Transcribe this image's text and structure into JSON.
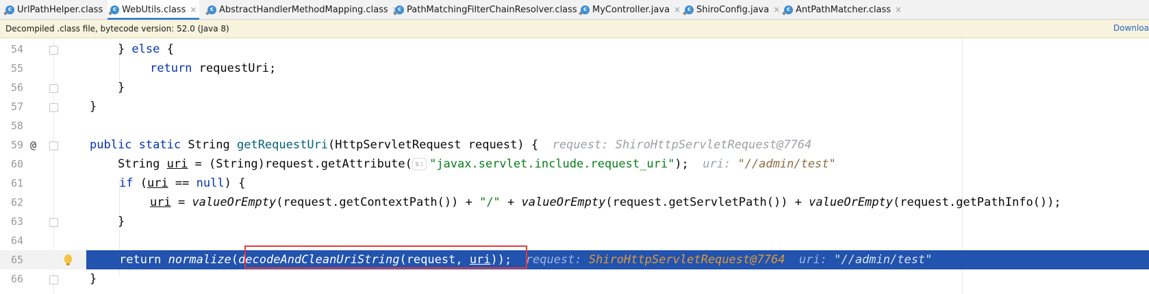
{
  "tabs": [
    {
      "label": "UrlPathHelper.class",
      "active": false,
      "icon": "class-icon"
    },
    {
      "label": "WebUtils.class",
      "active": true,
      "icon": "class-icon"
    },
    {
      "label": "AbstractHandlerMethodMapping.class",
      "active": false,
      "icon": "class-icon"
    },
    {
      "label": "PathMatchingFilterChainResolver.class",
      "active": false,
      "icon": "class-icon"
    },
    {
      "label": "MyController.java",
      "active": false,
      "icon": "class-icon"
    },
    {
      "label": "ShiroConfig.java",
      "active": false,
      "icon": "class-icon"
    },
    {
      "label": "AntPathMatcher.class",
      "active": false,
      "icon": "class-icon"
    }
  ],
  "tab_close_glyph": "×",
  "tab_icon_glyph": "c",
  "banner": {
    "message": "Decompiled .class file, bytecode version: 52.0 (Java 8)",
    "link": "Downloa"
  },
  "editor": {
    "lines": [
      {
        "num": "54"
      },
      {
        "num": "55"
      },
      {
        "num": "56"
      },
      {
        "num": "57"
      },
      {
        "num": "58"
      },
      {
        "num": "59",
        "marker": "@"
      },
      {
        "num": "60"
      },
      {
        "num": "61"
      },
      {
        "num": "62"
      },
      {
        "num": "63"
      },
      {
        "num": "64"
      },
      {
        "num": "65",
        "highlighted": true
      },
      {
        "num": "66"
      }
    ],
    "code": {
      "l54_a": "    } ",
      "l54_kw": "else",
      "l54_b": " {",
      "l55_kw": "return",
      "l55_b": " requestUri;",
      "l56": "    }",
      "l57": "}",
      "l59_kw1": "public",
      "l59_kw2": "static",
      "l59_type": " String ",
      "l59_fn": "getRequestUri",
      "l59_params": "(HttpServletRequest request) {",
      "l59_hint_key": "request: ",
      "l59_hint_val": "ShiroHttpServletRequest@7764",
      "l60_a": "    String ",
      "l60_var": "uri",
      "l60_b": " = (String)request.getAttribute(",
      "l60_pill": "s:",
      "l60_str": "\"javax.servlet.include.request_uri\"",
      "l60_c": ");",
      "l60_hint_key": "uri: ",
      "l60_hint_val": "\"//admin/test\"",
      "l61_kw": "if",
      "l61_a": " (",
      "l61_var": "uri",
      "l61_b": " == ",
      "l61_kw2": "null",
      "l61_c": ") {",
      "l62_var": "uri",
      "l62_a": " = ",
      "l62_f1": "valueOrEmpty",
      "l62_b": "(request.getContextPath()) + ",
      "l62_s1": "\"/\"",
      "l62_c": " + ",
      "l62_f2": "valueOrEmpty",
      "l62_d": "(request.getServletPath()) + ",
      "l62_f3": "valueOrEmpty",
      "l62_e": "(request.getPathInfo());",
      "l63": "    }",
      "l65_kw": "return",
      "l65_sp": " ",
      "l65_f1": "normalize",
      "l65_a": "(",
      "l65_f2": "decodeAndCleanUriString",
      "l65_b": "(request, ",
      "l65_var": "uri",
      "l65_c": "));",
      "l65_hint1_key": "request: ",
      "l65_hint1_val": "ShiroHttpServletRequest@7764",
      "l65_hint2_key": "uri: ",
      "l65_hint2_val": "\"//admin/test\"",
      "l66": "}"
    }
  },
  "colors": {
    "keyword": "#0033b3",
    "method": "#00627a",
    "string": "#067d17",
    "execution_line": "#2253ae",
    "annotation_box": "#e23b3b"
  }
}
